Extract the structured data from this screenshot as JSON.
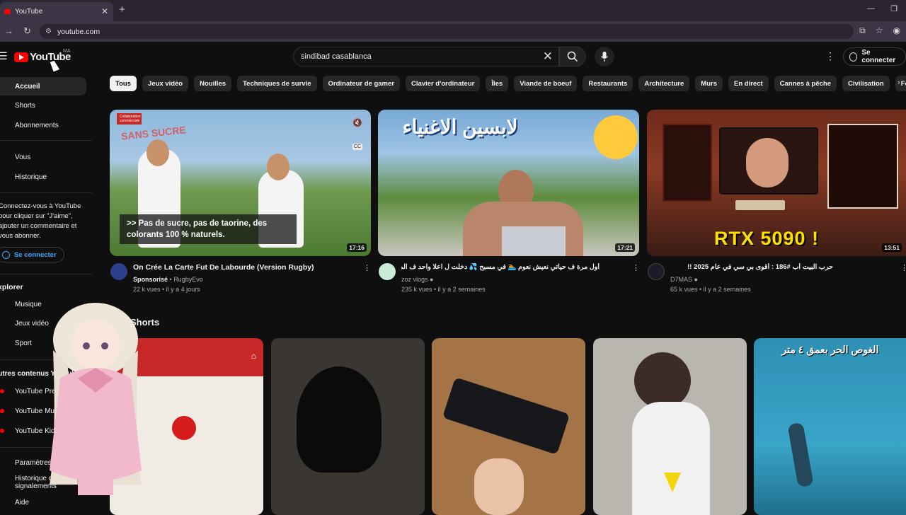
{
  "browser": {
    "tab_title": "YouTube",
    "tab_close": "✕",
    "new_tab": "+",
    "url": "youtube.com",
    "window_controls": [
      "—",
      "❐"
    ]
  },
  "header": {
    "logo_text": "YouTube",
    "country_code": "MA",
    "search_value": "sindibad casablanca",
    "signin_label": "Se connecter"
  },
  "sidebar": {
    "items_top": [
      {
        "label": "Accueil",
        "active": true
      },
      {
        "label": "Shorts"
      },
      {
        "label": "Abonnements"
      }
    ],
    "items_you": [
      {
        "label": "Vous"
      },
      {
        "label": "Historique"
      }
    ],
    "signin_prompt": "Connectez-vous à YouTube pour cliquer sur \"J'aime\", ajouter un commentaire et vous abonner.",
    "signin_button": "Se connecter",
    "explore_heading": "Explorer",
    "explore_items": [
      {
        "label": "Musique"
      },
      {
        "label": "Jeux vidéo"
      },
      {
        "label": "Sport"
      }
    ],
    "other_heading": "Autres contenus YouTube",
    "other_items": [
      {
        "label": "YouTube Premium"
      },
      {
        "label": "YouTube Music"
      },
      {
        "label": "YouTube Kids"
      }
    ],
    "bottom_items": [
      {
        "label": "Paramètres"
      },
      {
        "label": "Historique des signalements"
      },
      {
        "label": "Aide"
      }
    ]
  },
  "chips": [
    "Tous",
    "Jeux vidéo",
    "Nouilles",
    "Techniques de survie",
    "Ordinateur de gamer",
    "Clavier d'ordinateur",
    "Îles",
    "Viande de boeuf",
    "Restaurants",
    "Architecture",
    "Murs",
    "En direct",
    "Cannes à pêche",
    "Civilisation",
    "Fo"
  ],
  "videos": [
    {
      "title": "On Crée La Carte Fut De Labourde (Version Rugby)",
      "sponsored": "Sponsorisé",
      "channel": "RugbyEvo",
      "meta": "22 k vues • il y a 4 jours",
      "duration": "17:16",
      "thumb_caption": ">> Pas de sucre, pas de taorine, des colorants 100 % naturels.",
      "thumb_tag": "Collaboration commerciale",
      "thumb_headline": "SANS SUCRE",
      "avatar_color": "#2d3e8a"
    },
    {
      "title": "أول مرة ف حياتي نعيش نعوم 🏊 في مسبح 💦 دخلت ل اعلا واحد ف المغرب",
      "channel": "zoz vlogs",
      "meta": "235 k vues • il y a 2 semaines",
      "duration": "17:21",
      "thumb_headline": "لابسين الاغنياء",
      "avatar_color": "#c8ecd6"
    },
    {
      "title": "حرب البيت أب #186 : أقوى بي سي في عام 2025 !!",
      "channel": "D7MAS",
      "meta": "65 k vues • il y a 2 semaines",
      "duration": "13:51",
      "thumb_headline": "RTX 5090 !",
      "avatar_color": "#1c1c28"
    }
  ],
  "shorts": {
    "heading": "Shorts",
    "items": [
      {
        "bg": "#c62828"
      },
      {
        "bg": "#3a3631"
      },
      {
        "bg": "#a57446"
      },
      {
        "bg": "#b9b6b0"
      },
      {
        "bg": "#2f8fb5",
        "overlay_text": "الغوص الحر بعمق ٤ متر"
      }
    ]
  },
  "colors": {
    "brand": "#ff0000",
    "background": "#0f0f0f",
    "chip": "#272727",
    "link": "#3ea6ff"
  },
  "icons": [
    "menu-icon",
    "search-icon",
    "clear-icon",
    "mic-icon",
    "more-vert-icon",
    "user-circle-icon",
    "home-icon",
    "shorts-icon",
    "subscriptions-icon",
    "history-icon",
    "music-icon",
    "gaming-icon",
    "sport-icon",
    "settings-icon",
    "help-icon",
    "verified-icon",
    "mute-icon",
    "captions-icon"
  ]
}
